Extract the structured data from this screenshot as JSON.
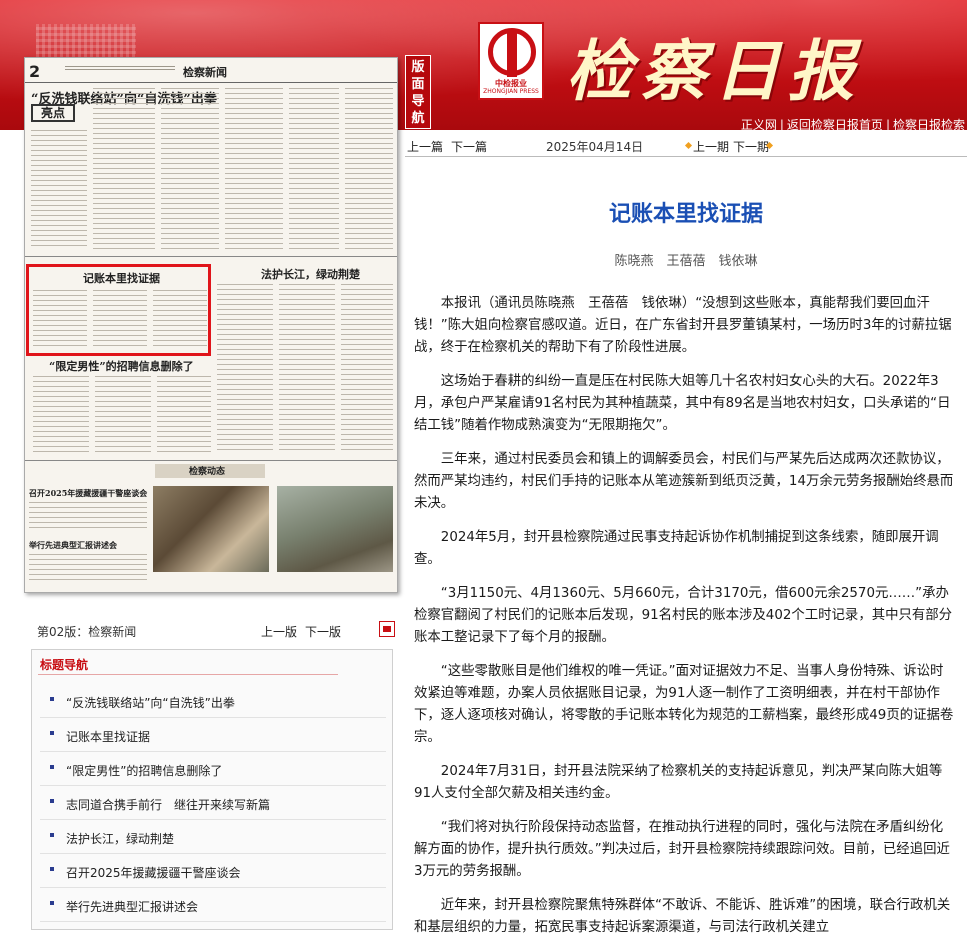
{
  "header": {
    "masthead": "检察日报",
    "banmian_daohang": "版面导航",
    "logo_text": "中检报业",
    "logo_sub": "ZHONGJIAN PRESS",
    "links": [
      "正义网",
      "返回检察日报首页",
      "检察日报检索"
    ]
  },
  "thumbnail": {
    "page_no": "2",
    "section": "检察新闻",
    "heads": [
      "“反洗钱联络站”向“自洗钱”出拳",
      "亮点",
      "记账本里找证据",
      "法护长江，绿动荆楚",
      "“限定男性”的招聘信息删除了",
      "检察动态",
      "召开2025年援藏援疆干警座谈会",
      "举行先进典型汇报讲述会"
    ]
  },
  "page_bar": {
    "banci": "第02版：检察新闻",
    "prev": "上一版",
    "next": "下一版",
    "pdf_icon": "pdf-icon"
  },
  "nav": {
    "title": "标题导航",
    "items": [
      "“反洗钱联络站”向“自洗钱”出拳",
      "记账本里找证据",
      "“限定男性”的招聘信息删除了",
      "志同道合携手前行　继往开来续写新篇",
      "法护长江，绿动荆楚",
      "召开2025年援藏援疆干警座谈会",
      "举行先进典型汇报讲述会"
    ]
  },
  "article_nav": {
    "prev_article": "上一篇",
    "next_article": "下一篇",
    "date": "2025年04月14日",
    "prev_issue": "上一期",
    "next_issue": "下一期"
  },
  "article": {
    "title": "记账本里找证据",
    "byline": "陈晓燕　王蓓蓓　钱依琳",
    "paragraphs": [
      "本报讯（通讯员陈晓燕　王蓓蓓　钱依琳）“没想到这些账本，真能帮我们要回血汗钱！”陈大姐向检察官感叹道。近日，在广东省封开县罗董镇某村，一场历时3年的讨薪拉锯战，终于在检察机关的帮助下有了阶段性进展。",
      "这场始于春耕的纠纷一直是压在村民陈大姐等几十名农村妇女心头的大石。2022年3月，承包户严某雇请91名村民为其种植蔬菜，其中有89名是当地农村妇女，口头承诺的“日结工钱”随着作物成熟演变为“无限期拖欠”。",
      "三年来，通过村民委员会和镇上的调解委员会，村民们与严某先后达成两次还款协议，然而严某均违约，村民们手持的记账本从笔迹簇新到纸页泛黄，14万余元劳务报酬始终悬而未决。",
      "2024年5月，封开县检察院通过民事支持起诉协作机制捕捉到这条线索，随即展开调查。",
      "“3月1150元、4月1360元、5月660元，合计3170元，借600元余2570元……”承办检察官翻阅了村民们的记账本后发现，91名村民的账本涉及402个工时记录，其中只有部分账本工整记录下了每个月的报酬。",
      "“这些零散账目是他们维权的唯一凭证。”面对证据效力不足、当事人身份特殊、诉讼时效紧迫等难题，办案人员依据账目记录，为91人逐一制作了工资明细表，并在村干部协作下，逐人逐项核对确认，将零散的手记账本转化为规范的工薪档案，最终形成49页的证据卷宗。",
      "2024年7月31日，封开县法院采纳了检察机关的支持起诉意见，判决严某向陈大姐等91人支付全部欠薪及相关违约金。",
      "“我们将对执行阶段保持动态监督，在推动执行进程的同时，强化与法院在矛盾纠纷化解方面的协作，提升执行质效。”判决过后，封开县检察院持续跟踪问效。目前，已经追回近3万元的劳务报酬。",
      "近年来，封开县检察院聚焦特殊群体“不敢诉、不能诉、胜诉难”的困境，联合行政机关和基层组织的力量，拓宽民事支持起诉案源渠道，与司法行政机关建立"
    ]
  }
}
